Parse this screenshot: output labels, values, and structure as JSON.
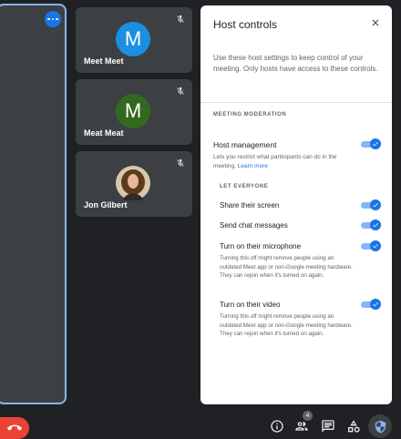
{
  "tiles": [
    {
      "name": "Meet Meet",
      "initial": "M",
      "color": "#1a8fe3"
    },
    {
      "name": "Meat Meat",
      "initial": "M",
      "color": "#33691e"
    },
    {
      "name": "Jon Gilbert"
    }
  ],
  "panel": {
    "title": "Host controls",
    "intro": "Use these host settings to keep control of your meeting. Only hosts have access to these controls.",
    "section": "MEETING MODERATION",
    "host_management": {
      "title": "Host management",
      "desc": "Lets you restrict what participants can do in the meeting.",
      "link": "Learn more",
      "on": true
    },
    "let_everyone": "LET EVERYONE",
    "items": [
      {
        "title": "Share their screen",
        "on": true
      },
      {
        "title": "Send chat messages",
        "on": true
      },
      {
        "title": "Turn on their microphone",
        "desc": "Turning this off might remove people using an outdated Meet app or non-Google meeting hardware. They can rejoin when it's turned on again.",
        "on": true
      },
      {
        "title": "Turn on their video",
        "desc": "Turning this off might remove people using an outdated Meet app or non-Google meeting hardware. They can rejoin when it's turned on again.",
        "on": true
      }
    ]
  },
  "bottom_bar": {
    "participant_count": "4",
    "icons": [
      "info-icon",
      "people-icon",
      "chat-icon",
      "activities-icon",
      "host-controls-icon"
    ]
  },
  "colors": {
    "accent": "#1a73e8",
    "end_call": "#ea4335",
    "tile": "#3c4043",
    "background": "#202124"
  }
}
